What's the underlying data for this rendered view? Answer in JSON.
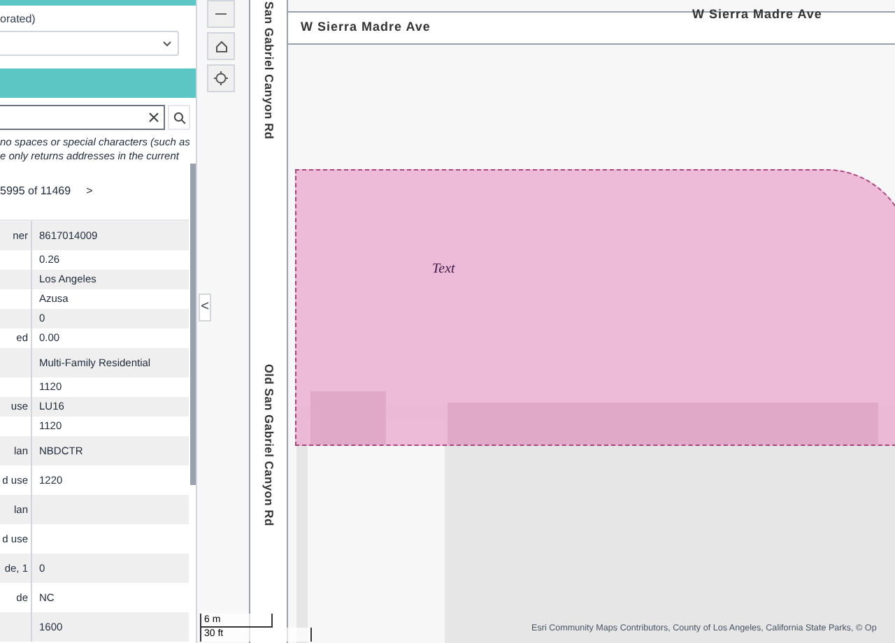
{
  "panel": {
    "dropdown_label": "orated)",
    "note_lines": [
      "no spaces or special characters (such as",
      "e only returns addresses in the current"
    ],
    "pager": {
      "text": "5995 of 11469",
      "next": ">"
    },
    "rows": [
      {
        "label": "ner",
        "value": "8617014009"
      },
      {
        "label": "",
        "value": "0.26"
      },
      {
        "label": "",
        "value": "Los Angeles"
      },
      {
        "label": "",
        "value": "Azusa"
      },
      {
        "label": "",
        "value": "0"
      },
      {
        "label": "ed",
        "value": "0.00"
      },
      {
        "label": "",
        "value": "Multi-Family Residential"
      },
      {
        "label": "",
        "value": "1120"
      },
      {
        "label": "use",
        "value": "LU16"
      },
      {
        "label": "",
        "value": "1120"
      },
      {
        "label": "lan",
        "value": "NBDCTR"
      },
      {
        "label": "d use",
        "value": "1220"
      },
      {
        "label": "lan",
        "value": ""
      },
      {
        "label": "d use",
        "value": ""
      },
      {
        "label": "de, 1",
        "value": "0"
      },
      {
        "label": "de",
        "value": "NC"
      },
      {
        "label": "",
        "value": "1600"
      }
    ]
  },
  "collapse_toggle": "<",
  "map": {
    "road_labels": [
      {
        "text": "San Gabriel Canyon Rd",
        "kind": "vertical"
      },
      {
        "text": "W Sierra Madre Ave",
        "kind": "horizontal"
      },
      {
        "text": "W Sierra Madre Ave",
        "kind": "horizontal"
      },
      {
        "text": "Old San Gabriel Canyon Rd",
        "kind": "vertical"
      }
    ],
    "parcel_label": "Text",
    "scale": [
      "6 m",
      "30 ft"
    ],
    "attribution": "Esri Community Maps Contributors, County of Los Angeles, California State Parks, © Op"
  }
}
